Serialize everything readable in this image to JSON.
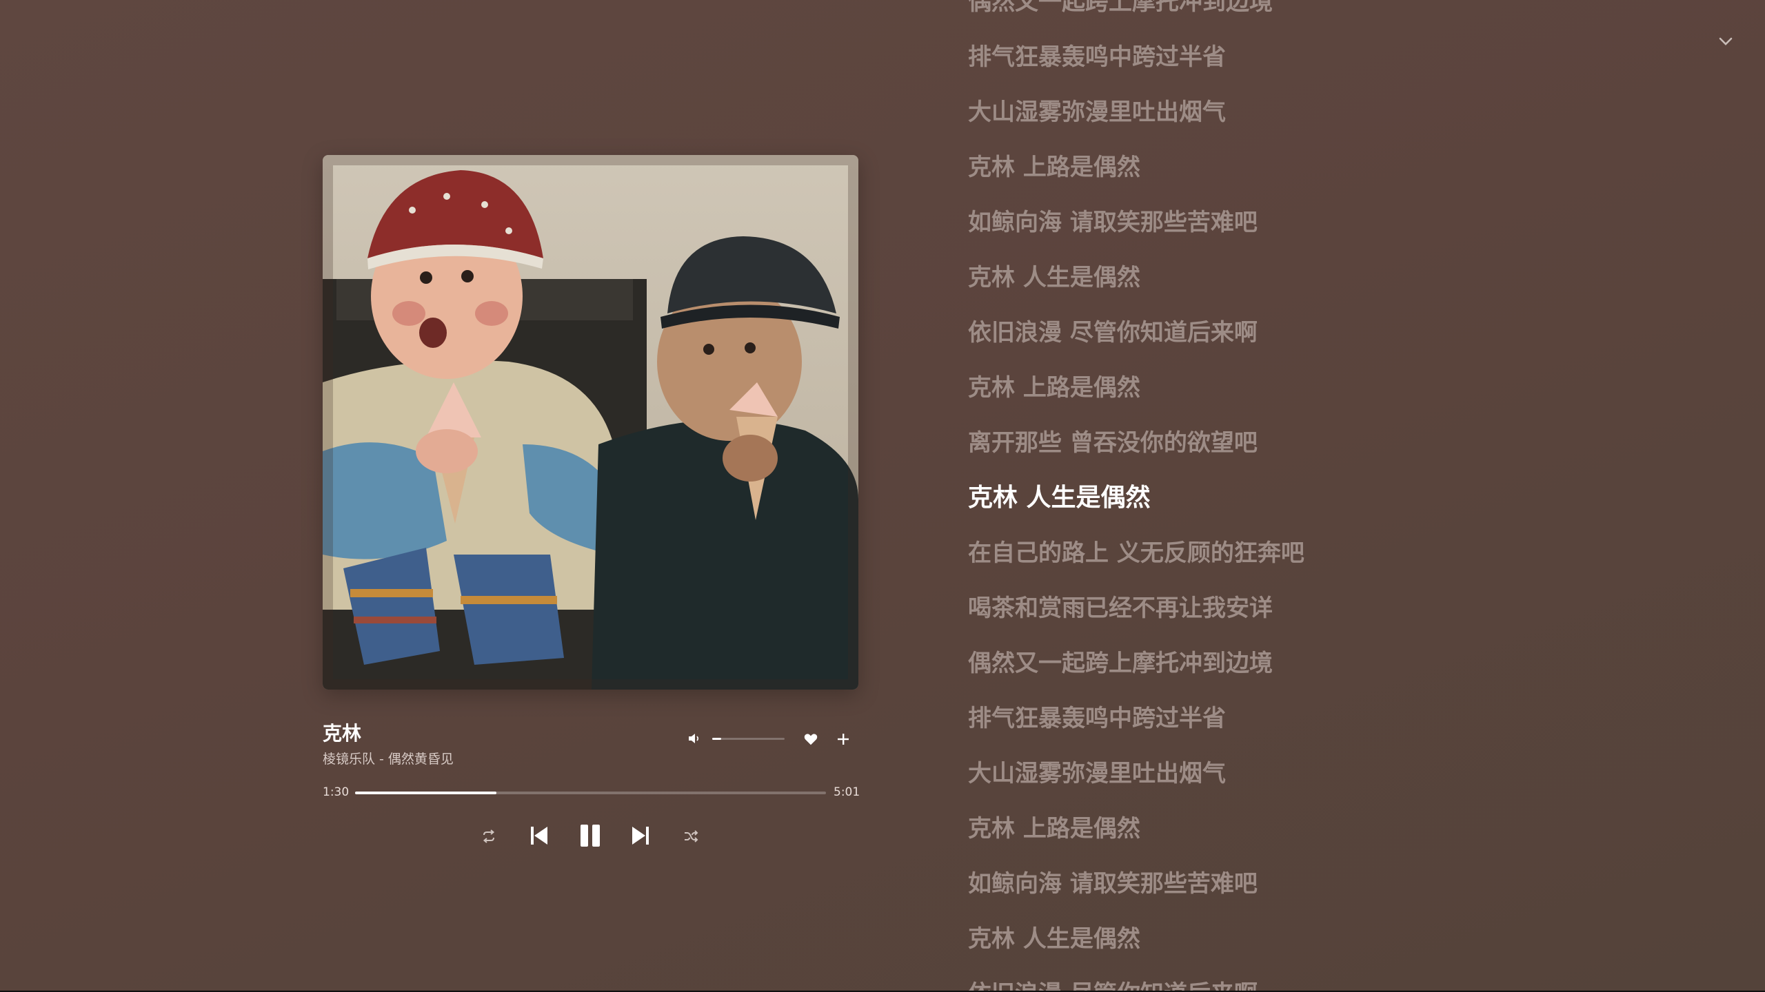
{
  "player": {
    "title": "克林",
    "subtitle": "棱镜乐队 - 偶然黄昏见",
    "elapsed": "1:30",
    "duration": "5:01",
    "progress_fraction": 0.3,
    "volume_fraction": 0.12
  },
  "icons": {
    "volume": "speaker-icon",
    "like": "heart-icon",
    "add": "plus-icon",
    "repeat": "repeat-icon",
    "previous": "skip-previous-icon",
    "play_state": "pause-icon",
    "next": "skip-next-icon",
    "shuffle": "shuffle-icon",
    "collapse": "chevron-down-icon"
  },
  "lyrics": {
    "active_index": 9,
    "lines": [
      "偶然又一起跨上摩托冲到边境",
      "排气狂暴轰鸣中跨过半省",
      "大山湿雾弥漫里吐出烟气",
      "克林 上路是偶然",
      "如鲸向海 请取笑那些苦难吧",
      "克林 人生是偶然",
      "依旧浪漫 尽管你知道后来啊",
      "克林 上路是偶然",
      "离开那些 曾吞没你的欲望吧",
      "克林 人生是偶然",
      "在自己的路上 义无反顾的狂奔吧",
      "喝茶和赏雨已经不再让我安详",
      "偶然又一起跨上摩托冲到边境",
      "排气狂暴轰鸣中跨过半省",
      "大山湿雾弥漫里吐出烟气",
      "克林 上路是偶然",
      "如鲸向海 请取笑那些苦难吧",
      "克林 人生是偶然",
      "依旧浪漫 尽管你知道后来啊"
    ]
  },
  "colors": {
    "background": "#5b443d",
    "lyric_inactive": "#9d8c86",
    "lyric_active": "#ffffff"
  }
}
